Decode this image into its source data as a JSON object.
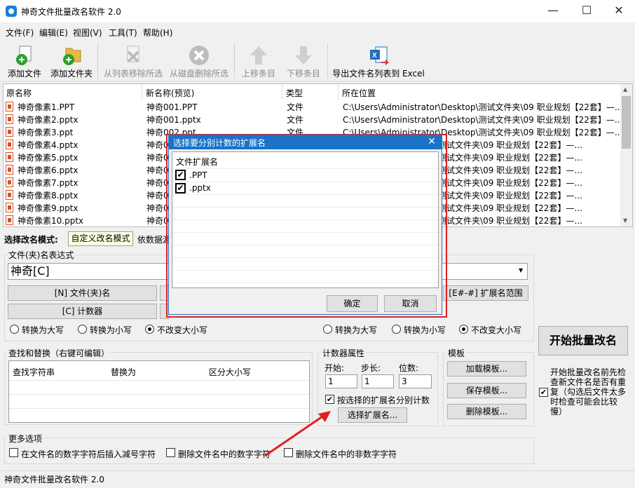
{
  "window": {
    "title": "神奇文件批量改名软件 2.0",
    "minimize": "—",
    "maximize": "☐",
    "close": "✕"
  },
  "menu": [
    "文件(F)",
    "编辑(E)",
    "视图(V)",
    "工具(T)",
    "帮助(H)"
  ],
  "toolbar": [
    {
      "label": "添加文件",
      "icon": "add-file-icon",
      "enabled": true
    },
    {
      "label": "添加文件夹",
      "icon": "add-folder-icon",
      "enabled": true
    },
    {
      "label": "从列表移除所选",
      "icon": "remove-from-list-icon",
      "enabled": false
    },
    {
      "label": "从磁盘删除所选",
      "icon": "delete-from-disk-icon",
      "enabled": false
    },
    {
      "label": "上移条目",
      "icon": "move-up-icon",
      "enabled": false
    },
    {
      "label": "下移条目",
      "icon": "move-down-icon",
      "enabled": false
    },
    {
      "label": "导出文件名列表到 Excel",
      "icon": "excel-export-icon",
      "enabled": true
    }
  ],
  "filelist": {
    "columns": [
      "原名称",
      "新名称(预览)",
      "类型",
      "所在位置"
    ],
    "rows": [
      {
        "orig": "神奇像素1.PPT",
        "new": "神奇001.PPT",
        "type": "文件",
        "path": "C:\\Users\\Administrator\\Desktop\\测试文件夹\\09 职业规划【22套】—..."
      },
      {
        "orig": "神奇像素2.pptx",
        "new": "神奇001.pptx",
        "type": "文件",
        "path": "C:\\Users\\Administrator\\Desktop\\测试文件夹\\09 职业规划【22套】—..."
      },
      {
        "orig": "神奇像素3.ppt",
        "new": "神奇002.ppt",
        "type": "文件",
        "path": "C:\\Users\\Administrator\\Desktop\\测试文件夹\\09 职业规划【22套】—..."
      },
      {
        "orig": "神奇像素4.pptx",
        "new": "神奇0",
        "type": "",
        "path": "\\测试文件夹\\09 职业规划【22套】—..."
      },
      {
        "orig": "神奇像素5.pptx",
        "new": "神奇0",
        "type": "",
        "path": "\\测试文件夹\\09 职业规划【22套】—..."
      },
      {
        "orig": "神奇像素6.pptx",
        "new": "神奇0",
        "type": "",
        "path": "\\测试文件夹\\09 职业规划【22套】—..."
      },
      {
        "orig": "神奇像素7.pptx",
        "new": "神奇0",
        "type": "",
        "path": "\\测试文件夹\\09 职业规划【22套】—..."
      },
      {
        "orig": "神奇像素8.pptx",
        "new": "神奇0",
        "type": "",
        "path": "\\测试文件夹\\09 职业规划【22套】—..."
      },
      {
        "orig": "神奇像素9.pptx",
        "new": "神奇0",
        "type": "",
        "path": "\\测试文件夹\\09 职业规划【22套】—..."
      },
      {
        "orig": "神奇像素10.pptx",
        "new": "神奇0",
        "type": "",
        "path": "\\测试文件夹\\09 职业规划【22套】—..."
      }
    ]
  },
  "mode": {
    "label": "选择改名模式:",
    "active_tab": "自定义改名模式",
    "other_tab": "依数据源"
  },
  "expression": {
    "group_title": "文件(夹)名表达式",
    "value": "神奇[C]",
    "btn_name": "[N] 文件(夹)名",
    "btn_counter": "[C] 计数器",
    "btn_ext_range": "[E#-#] 扩展名范围",
    "case_options": [
      "转换为大写",
      "转换为小写",
      "不改变大小写"
    ],
    "case_selected": 2
  },
  "ext_case_options": [
    "转换为大写",
    "转换为小写",
    "不改变大小写"
  ],
  "start_button": "开始批量改名",
  "precheck_label": "开始批量改名前先检查新文件名是否有重复（勾选后文件太多时检查可能会比较慢）",
  "find_replace": {
    "group_title": "查找和替换（右键可编辑）",
    "columns": [
      "查找字符串",
      "替换为",
      "区分大小写"
    ]
  },
  "counter": {
    "group_title": "计数器属性",
    "start_label": "开始:",
    "step_label": "步长:",
    "digits_label": "位数:",
    "start": "1",
    "step": "1",
    "digits": "3",
    "per_ext_label": "按选择的扩展名分别计数",
    "select_ext_button": "选择扩展名..."
  },
  "template": {
    "group_title": "模板",
    "load": "加载模板...",
    "save": "保存模板...",
    "delete": "删除模板..."
  },
  "more_options": {
    "group_title": "更多选项",
    "opt1": "在文件名的数字字符后插入减号字符",
    "opt2": "删除文件名中的数字字符",
    "opt3": "删除文件名中的非数字字符"
  },
  "dialog": {
    "title": "选择要分别计数的扩展名",
    "header": "文件扩展名",
    "items": [
      ".PPT",
      ".pptx"
    ],
    "ok": "确定",
    "cancel": "取消"
  },
  "status": "神奇文件批量改名软件 2.0",
  "colors": {
    "accent": "#1a73c9",
    "highlight_border": "#e02020",
    "arrow": "#e02020"
  }
}
